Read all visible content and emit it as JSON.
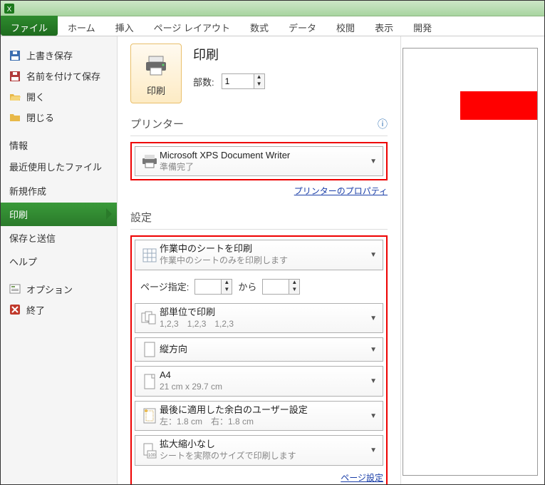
{
  "ribbon": {
    "tabs": [
      "ファイル",
      "ホーム",
      "挿入",
      "ページ レイアウト",
      "数式",
      "データ",
      "校閲",
      "表示",
      "開発"
    ]
  },
  "sidebar": {
    "items": [
      {
        "label": "上書き保存",
        "icon": "save"
      },
      {
        "label": "名前を付けて保存",
        "icon": "saveas"
      },
      {
        "label": "開く",
        "icon": "open"
      },
      {
        "label": "閉じる",
        "icon": "close"
      }
    ],
    "sections": [
      "情報",
      "最近使用したファイル",
      "新規作成",
      "印刷",
      "保存と送信",
      "ヘルプ"
    ],
    "footer": [
      {
        "label": "オプション",
        "icon": "options"
      },
      {
        "label": "終了",
        "icon": "exit"
      }
    ]
  },
  "print": {
    "title": "印刷",
    "button": "印刷",
    "copies_label": "部数:",
    "copies_value": "1",
    "printer_head": "プリンター",
    "printer": {
      "name": "Microsoft XPS Document Writer",
      "status": "準備完了"
    },
    "printer_props": "プリンターのプロパティ",
    "settings_head": "設定",
    "settings": {
      "scope": {
        "title": "作業中のシートを印刷",
        "sub": "作業中のシートのみを印刷します"
      },
      "pages_label": "ページ指定:",
      "pages_sep": "から",
      "collate": {
        "title": "部単位で印刷",
        "sub": "1,2,3　1,2,3　1,2,3"
      },
      "orientation": {
        "title": "縦方向"
      },
      "paper": {
        "title": "A4",
        "sub": "21 cm x 29.7 cm"
      },
      "margins": {
        "title": "最後に適用した余白のユーザー設定",
        "sub": "左：1.8 cm　右：1.8 cm"
      },
      "scaling": {
        "title": "拡大縮小なし",
        "sub": "シートを実際のサイズで印刷します"
      }
    },
    "page_setup": "ページ設定"
  }
}
